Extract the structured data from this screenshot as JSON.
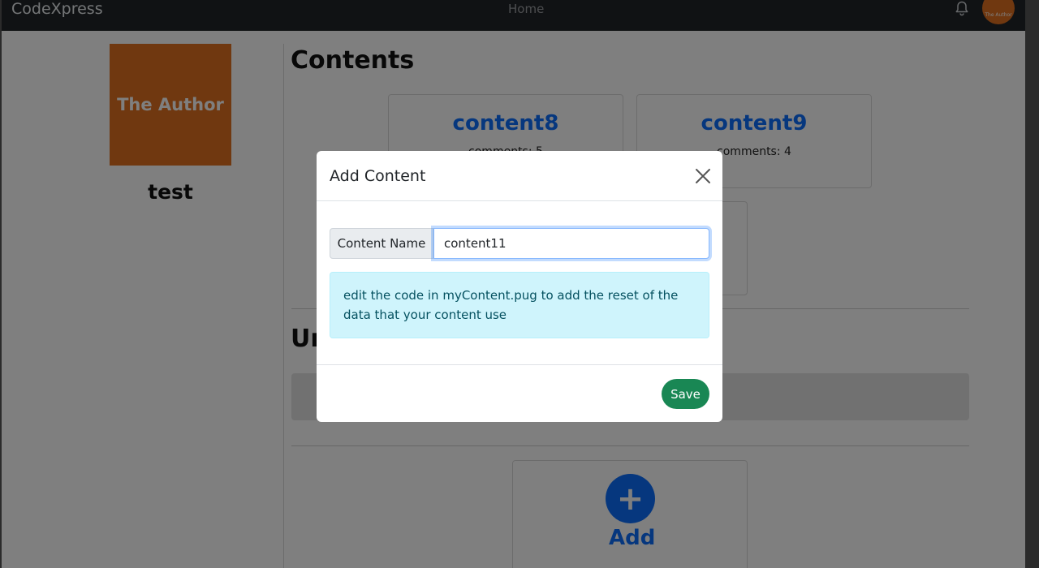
{
  "navbar": {
    "brand": "CodeXpress",
    "home_link": "Home",
    "avatar_text": "The Author"
  },
  "profile": {
    "image_text": "The Author",
    "username": "test"
  },
  "main": {
    "contents_title": "Contents",
    "cards": [
      {
        "title": "content8",
        "comments": "comments: 5"
      },
      {
        "title": "content9",
        "comments": "comments: 4"
      }
    ],
    "second_section_title_partial": "Ur",
    "add_label": "Add",
    "add_icon": "+"
  },
  "modal": {
    "title": "Add Content",
    "input_label": "Content Name",
    "input_value": "content11",
    "alert_text": "edit the code in myContent.pug to add the reset of the data that your content use",
    "save_label": "Save"
  },
  "colors": {
    "accent_orange": "#e07020",
    "primary_blue": "#0d6efd",
    "success_green": "#198754",
    "info_bg": "#cff4fc"
  }
}
